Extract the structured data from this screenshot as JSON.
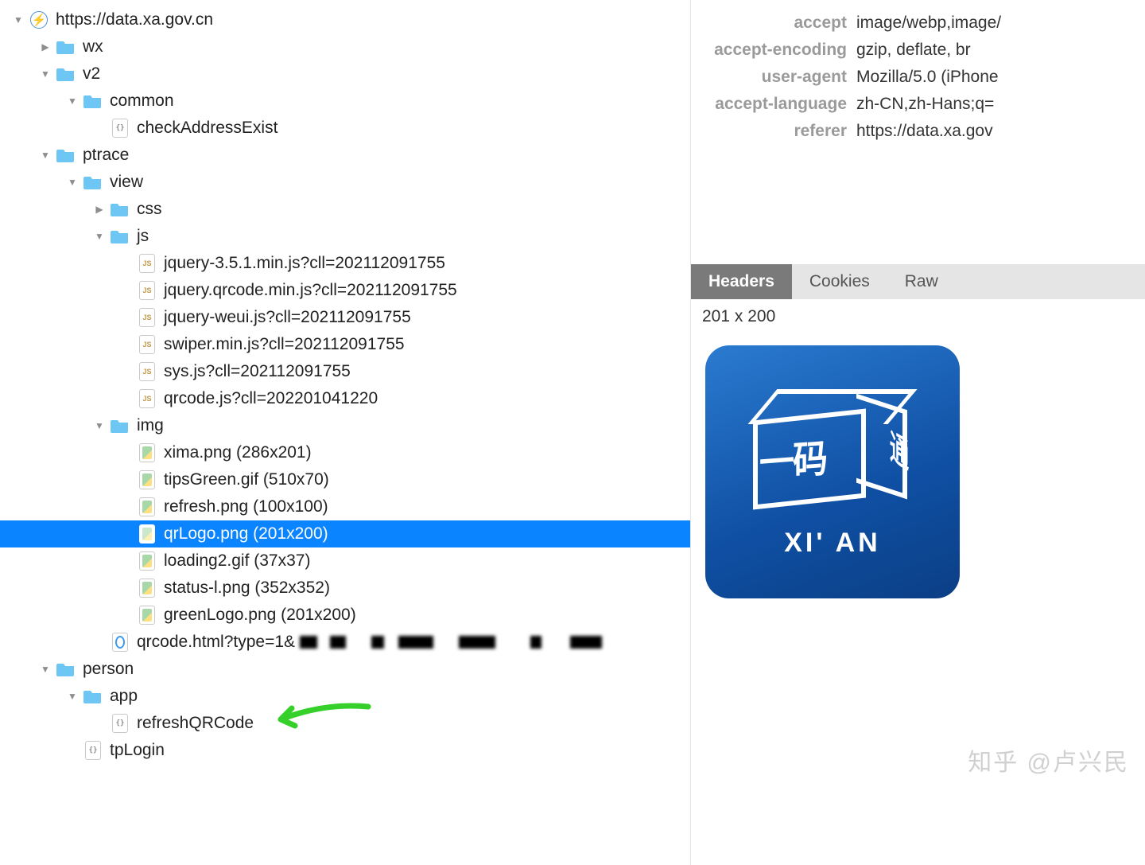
{
  "tree": {
    "root": "https://data.xa.gov.cn",
    "wx": "wx",
    "v2": "v2",
    "common": "common",
    "checkAddressExist": "checkAddressExist",
    "ptrace": "ptrace",
    "view": "view",
    "css": "css",
    "js": "js",
    "js_files": [
      "jquery-3.5.1.min.js?cll=202112091755",
      "jquery.qrcode.min.js?cll=202112091755",
      "jquery-weui.js?cll=202112091755",
      "swiper.min.js?cll=202112091755",
      "sys.js?cll=202112091755",
      "qrcode.js?cll=202201041220"
    ],
    "img": "img",
    "img_files": [
      "xima.png (286x201)",
      "tipsGreen.gif (510x70)",
      "refresh.png (100x100)",
      "qrLogo.png (201x200)",
      "loading2.gif (37x37)",
      "status-l.png (352x352)",
      "greenLogo.png (201x200)"
    ],
    "qrcode_html": "qrcode.html?type=1&",
    "person": "person",
    "app": "app",
    "refreshQRCode": "refreshQRCode",
    "tpLogin": "tpLogin"
  },
  "selected_index": 3,
  "headers": [
    {
      "name": "accept",
      "value": "image/webp,image/"
    },
    {
      "name": "accept-encoding",
      "value": "gzip, deflate, br"
    },
    {
      "name": "user-agent",
      "value": "Mozilla/5.0 (iPhone"
    },
    {
      "name": "accept-language",
      "value": "zh-CN,zh-Hans;q="
    },
    {
      "name": "referer",
      "value": "https://data.xa.gov"
    }
  ],
  "tabs": [
    "Headers",
    "Cookies",
    "Raw"
  ],
  "active_tab": 0,
  "preview_dim": "201 x 200",
  "brand_text": "XI' AN",
  "cube_main": "一码",
  "cube_side": "通",
  "watermark": "知乎 @卢兴民"
}
